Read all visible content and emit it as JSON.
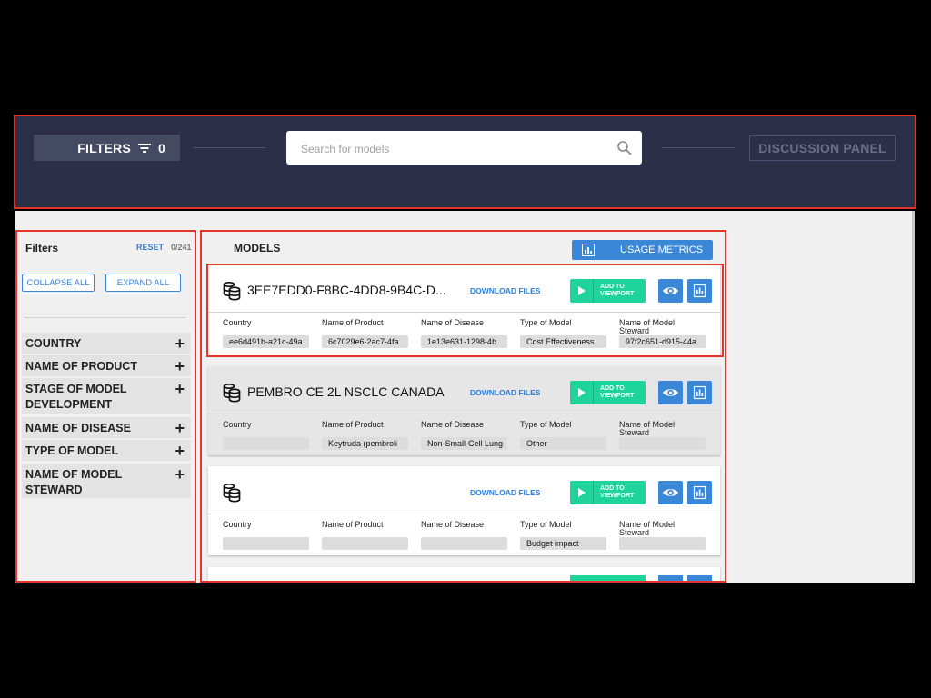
{
  "header": {
    "filters_label": "FILTERS",
    "filters_count": "0",
    "search_placeholder": "Search for models",
    "discussion_label": "DISCUSSION PANEL"
  },
  "sidebar": {
    "title": "Filters",
    "reset_label": "RESET",
    "count_label": "0/241",
    "collapse_label": "COLLAPSE ALL",
    "expand_label": "EXPAND ALL",
    "facets": [
      {
        "label": "COUNTRY"
      },
      {
        "label": "NAME OF PRODUCT"
      },
      {
        "label": "STAGE OF MODEL DEVELOPMENT"
      },
      {
        "label": "NAME OF DISEASE"
      },
      {
        "label": "TYPE OF MODEL"
      },
      {
        "label": "NAME OF MODEL STEWARD"
      }
    ]
  },
  "models": {
    "title": "MODELS",
    "usage_label": "USAGE METRICS",
    "download_label": "DOWNLOAD FILES",
    "add_viewport_line1": "ADD TO",
    "add_viewport_line2": "VIEWPORT",
    "field_labels": [
      "Country",
      "Name of Product",
      "Name of Disease",
      "Type of Model",
      "Name of Model Steward"
    ],
    "cards": [
      {
        "title": "3EE7EDD0-F8BC-4DD8-9B4C-D...",
        "values": [
          "ee6d491b-a21c-49a",
          "6c7029e6-2ac7-4fa",
          "1e13e631-1298-4b",
          "Cost Effectiveness",
          "97f2c651-d915-44a"
        ]
      },
      {
        "title": "PEMBRO CE 2L NSCLC CANADA",
        "values": [
          "",
          "Keytruda (pembroli",
          "Non-Small-Cell Lung",
          "Other",
          ""
        ]
      },
      {
        "title": "",
        "values": [
          "",
          "",
          "",
          "Budget impact",
          ""
        ]
      }
    ]
  },
  "colors": {
    "header_bg": "#2b2f48",
    "accent_blue": "#3a87d8",
    "accent_green": "#1ed49b",
    "highlight_red": "#e5342a"
  },
  "icons": [
    "filter-icon",
    "search-icon",
    "database-icon",
    "play-icon",
    "eye-icon",
    "bar-chart-icon",
    "plus-icon"
  ]
}
